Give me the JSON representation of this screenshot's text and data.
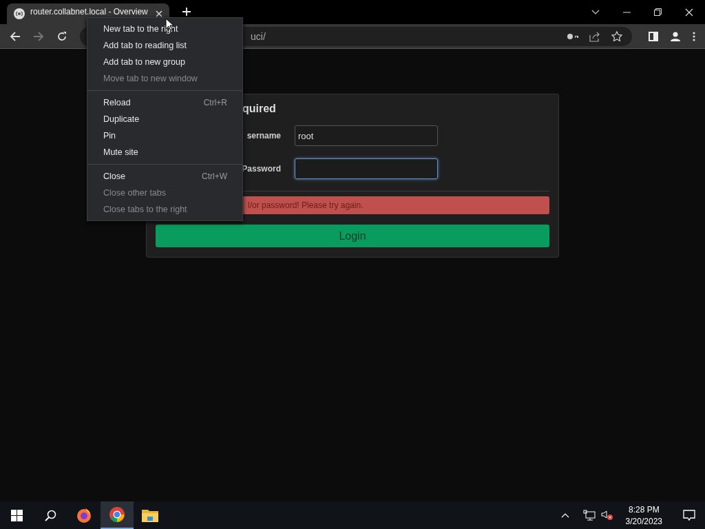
{
  "tab": {
    "title": "router.collabnet.local - Overview",
    "selected": true
  },
  "address_bar": {
    "value": "uci/"
  },
  "login": {
    "title": "quired",
    "fields": [
      {
        "label": "sername",
        "value": "root",
        "focused": false
      },
      {
        "label": "Password",
        "focused": true
      }
    ],
    "error": "l/or password! Please try again.",
    "button": "Login"
  },
  "context_menu": {
    "groups": [
      [
        {
          "label": "New tab to the right",
          "disabled": false
        },
        {
          "label": "Add tab to reading list",
          "disabled": false
        },
        {
          "label": "Add tab to new group",
          "disabled": false
        },
        {
          "label": "Move tab to new window",
          "disabled": true
        }
      ],
      [
        {
          "label": "Reload",
          "shortcut": "Ctrl+R",
          "disabled": false
        },
        {
          "label": "Duplicate",
          "disabled": false
        },
        {
          "label": "Pin",
          "disabled": false
        },
        {
          "label": "Mute site",
          "disabled": false
        }
      ],
      [
        {
          "label": "Close",
          "shortcut": "Ctrl+W",
          "disabled": false
        },
        {
          "label": "Close other tabs",
          "disabled": true
        },
        {
          "label": "Close tabs to the right",
          "disabled": true
        }
      ]
    ]
  },
  "taskbar": {
    "apps": [
      {
        "kind": "firefox",
        "selected": false
      },
      {
        "kind": "chrome",
        "selected": true
      },
      {
        "kind": "folder",
        "selected": false
      }
    ],
    "time": "8:28 PM",
    "date": "3/20/2023"
  }
}
